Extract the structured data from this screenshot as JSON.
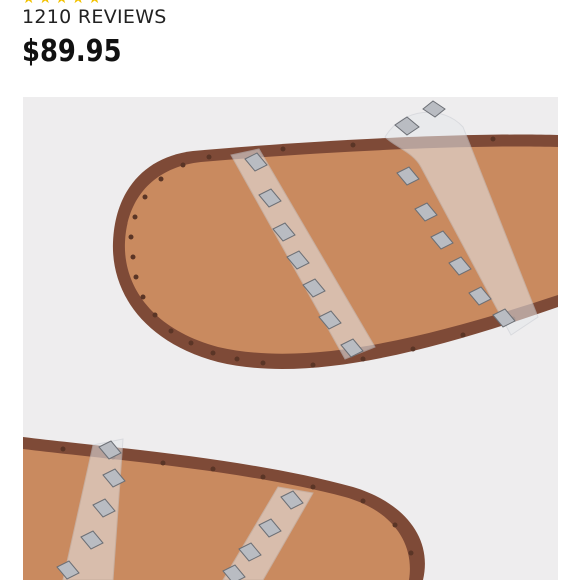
{
  "rating": {
    "stars": 5,
    "star_color": "#f2c200",
    "reviews_label": "1210 REVIEWS"
  },
  "product": {
    "price": "$89.95",
    "image": {
      "icon": "studded-clear-strap-slide-sandal-photo",
      "colors": {
        "background": "#eeedee",
        "footbed": "#c98a5f",
        "sole_edge": "#7e4a37",
        "straps": "#e6e8ec",
        "studs": "#b9bcc2"
      }
    }
  }
}
